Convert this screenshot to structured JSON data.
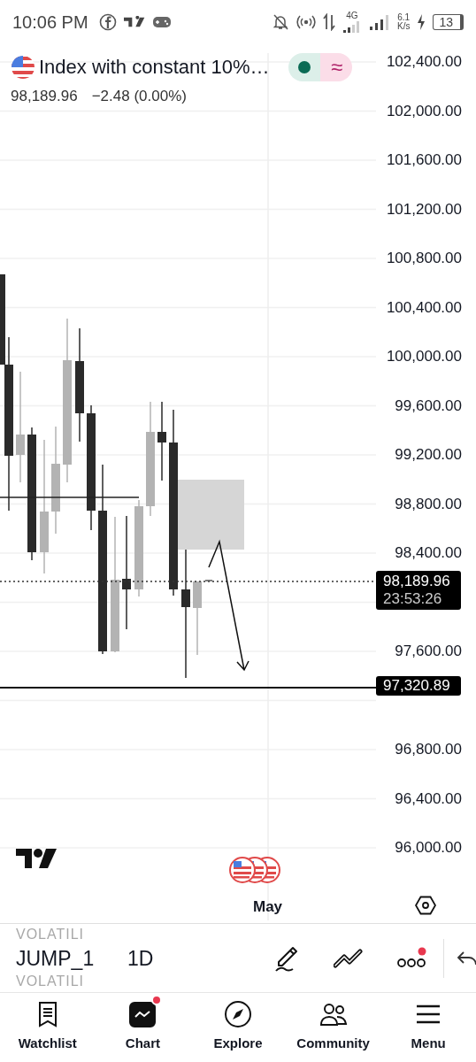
{
  "status_bar": {
    "time": "10:06 PM",
    "network": "4G",
    "speed_value": "6.1",
    "speed_unit": "K/s",
    "battery": "13"
  },
  "symbol": {
    "title": "Index with constant 10%…",
    "price": "98,189.96",
    "change": "−2.48 (0.00%)",
    "market_open": true,
    "indicator_symbol": "≈"
  },
  "price_axis": [
    "102,400.00",
    "102,000.00",
    "101,600.00",
    "101,200.00",
    "100,800.00",
    "100,400.00",
    "100,000.00",
    "99,600.00",
    "99,200.00",
    "98,800.00",
    "98,400.00",
    "97,600.00",
    "96,800.00",
    "96,400.00",
    "96,000.00"
  ],
  "price_tags": [
    {
      "kind": "last",
      "price": "98,189.96",
      "countdown": "23:53:26"
    },
    {
      "kind": "line",
      "price": "97,320.89"
    }
  ],
  "time_axis": {
    "label": "May"
  },
  "toolbar": {
    "symbol_above": "VOLATILI",
    "symbol": "JUMP_1",
    "symbol_below": "VOLATILI",
    "interval": "1D",
    "more_notification": true
  },
  "nav": [
    {
      "label": "Watchlist",
      "selected": false,
      "badge": false
    },
    {
      "label": "Chart",
      "selected": true,
      "badge": true
    },
    {
      "label": "Explore",
      "selected": false,
      "badge": false
    },
    {
      "label": "Community",
      "selected": false,
      "badge": false
    },
    {
      "label": "Menu",
      "selected": false,
      "badge": false
    }
  ]
}
